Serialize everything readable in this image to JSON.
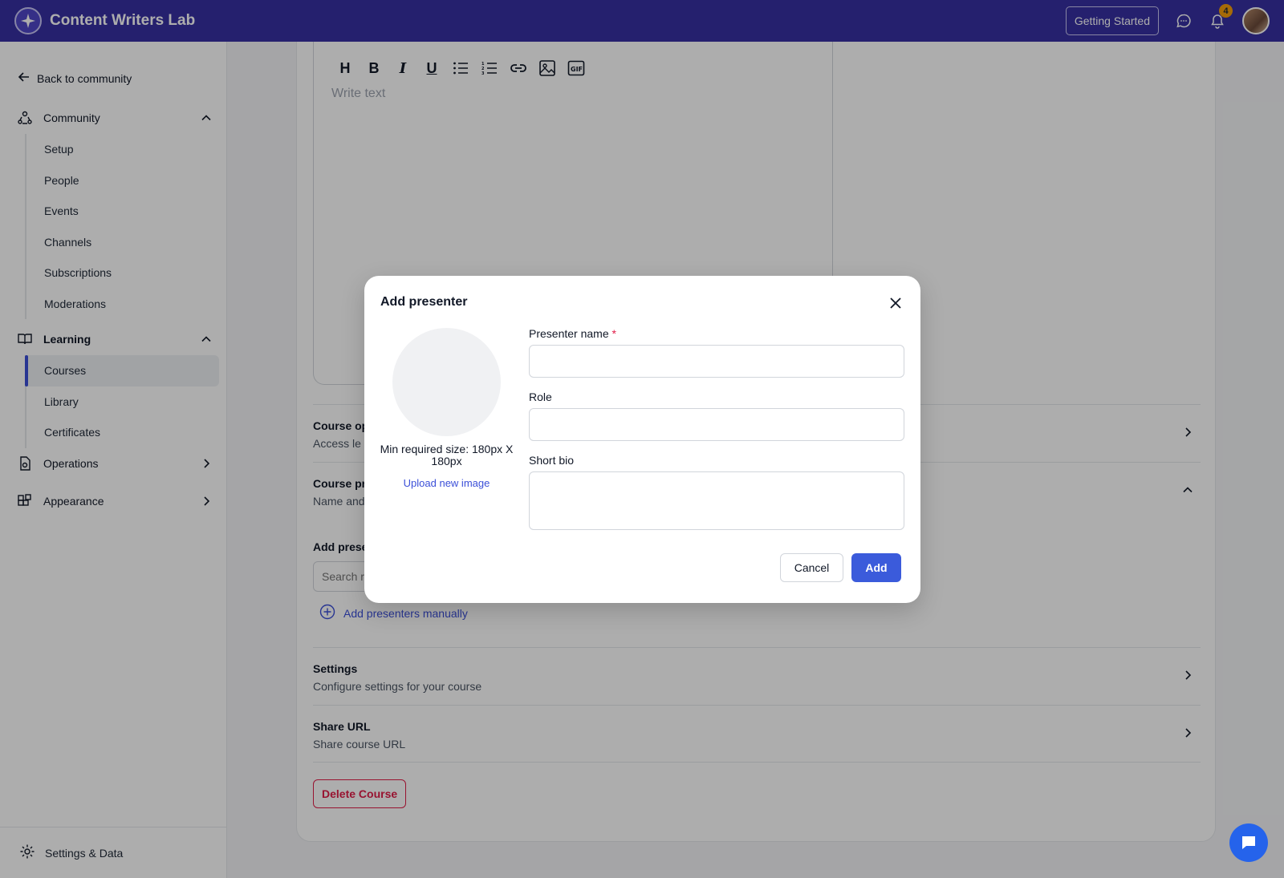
{
  "app": {
    "name": "Content Writers Lab"
  },
  "topbar": {
    "getting_started": "Getting Started",
    "notification_count": "4"
  },
  "sidebar": {
    "back": "Back to community",
    "community": {
      "label": "Community",
      "items": [
        "Setup",
        "People",
        "Events",
        "Channels",
        "Subscriptions",
        "Moderations"
      ]
    },
    "learning": {
      "label": "Learning",
      "items": [
        "Courses",
        "Library",
        "Certificates"
      ],
      "active": "Courses"
    },
    "operations": "Operations",
    "appearance": "Appearance",
    "footer": "Settings & Data"
  },
  "editor": {
    "placeholder": "Write text",
    "tools": [
      "H",
      "B",
      "I",
      "U",
      "bullet-list-icon",
      "numbered-list-icon",
      "link-icon",
      "image-icon",
      "gif-icon"
    ]
  },
  "sections": {
    "course_options": {
      "title": "Course op",
      "subtitle": "Access le"
    },
    "course_presenters": {
      "title": "Course pr",
      "subtitle": "Name and"
    },
    "add_presenters_label": "Add prese",
    "search_placeholder": "Search r",
    "add_manually": "Add presenters manually",
    "settings": {
      "title": "Settings",
      "subtitle": "Configure settings for your course"
    },
    "share_url": {
      "title": "Share URL",
      "subtitle": "Share course URL"
    },
    "delete": "Delete Course"
  },
  "modal": {
    "title": "Add presenter",
    "min_size": "Min required size: 180px X 180px",
    "upload": "Upload new image",
    "fields": {
      "name_label": "Presenter name",
      "required_mark": "*",
      "role_label": "Role",
      "bio_label": "Short bio"
    },
    "cancel": "Cancel",
    "add": "Add"
  },
  "colors": {
    "topbar": "#3730a3",
    "accent": "#3b5bdb",
    "danger": "#e11d48"
  }
}
